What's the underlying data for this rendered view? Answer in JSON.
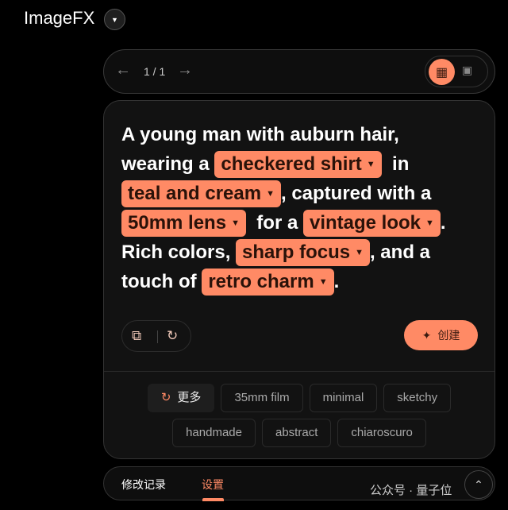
{
  "app": {
    "title": "ImageFX",
    "dropdown_icon": "caret-down-icon"
  },
  "pager": {
    "prev_icon": "arrow-left-icon",
    "page": "1 / 1",
    "next_icon": "arrow-right-icon",
    "views": [
      "grid-view-icon",
      "single-view-icon"
    ],
    "active_view": "grid"
  },
  "prompt": {
    "lines": [
      [
        {
          "t": "A young man with auburn hair,"
        }
      ],
      [
        {
          "t": "wearing a "
        },
        {
          "chip": "checkered shirt"
        },
        {
          "t": "  in"
        }
      ],
      [
        {
          "chip": "teal and cream"
        },
        {
          "t": ", captured with a"
        }
      ],
      [
        {
          "chip": "50mm lens"
        },
        {
          "t": "  for a "
        },
        {
          "chip": "vintage look"
        },
        {
          "t": "."
        }
      ],
      [
        {
          "t": "Rich colors, "
        },
        {
          "chip": "sharp focus"
        },
        {
          "t": ", and a"
        }
      ],
      [
        {
          "t": "touch of "
        },
        {
          "chip": "retro charm"
        },
        {
          "t": "."
        }
      ]
    ]
  },
  "tools": {
    "copy_icon": "copy-icon",
    "reset_icon": "reset-icon"
  },
  "create": {
    "label": "创建",
    "icon": "sparkle-icon"
  },
  "suggestions": {
    "more_label": "更多",
    "rows": [
      [
        "35mm film",
        "minimal",
        "sketchy"
      ],
      [
        "handmade",
        "abstract",
        "chiaroscuro"
      ]
    ]
  },
  "bottom": {
    "tabs": [
      "修改记录",
      "设置"
    ],
    "active_tab": 1,
    "watermark": "公众号 · 量子位"
  },
  "colors": {
    "accent": "#ff8a65",
    "background": "#000000",
    "card": "#121212"
  }
}
